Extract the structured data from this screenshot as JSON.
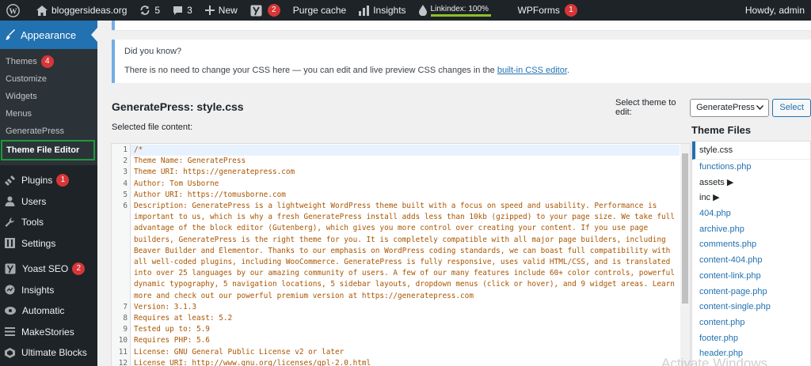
{
  "adminbar": {
    "site_name": "bloggersideas.org",
    "updates_count": "5",
    "comments_count": "3",
    "new_label": "New",
    "yoast_count": "2",
    "purge_cache": "Purge cache",
    "insights": "Insights",
    "linkindex_label": "Linkindex: 100%",
    "linkindex_fraction": 1.0,
    "wpforms_label": "WPForms",
    "wpforms_count": "1",
    "howdy": "Howdy, admin"
  },
  "sidebar": {
    "appearance": "Appearance",
    "submenu": [
      {
        "label": "Themes",
        "badge": "4"
      },
      {
        "label": "Customize"
      },
      {
        "label": "Widgets"
      },
      {
        "label": "Menus"
      },
      {
        "label": "GeneratePress"
      },
      {
        "label": "Theme File Editor",
        "current": true
      }
    ],
    "plugins": "Plugins",
    "plugins_badge": "1",
    "users": "Users",
    "tools": "Tools",
    "settings": "Settings",
    "yoast": "Yoast SEO",
    "yoast_badge": "2",
    "insights": "Insights",
    "automatic": "Automatic",
    "makestories": "MakeStories",
    "ultimate_blocks": "Ultimate Blocks"
  },
  "notice": {
    "title": "Did you know?",
    "text_before": "There is no need to change your CSS here — you can edit and live preview CSS changes in the ",
    "link": "built-in CSS editor",
    "text_after": "."
  },
  "editor": {
    "title": "GeneratePress: style.css",
    "select_label": "Select theme to edit:",
    "selected_theme": "GeneratePress",
    "select_button": "Select",
    "selected_file_content": "Selected file content:",
    "lines": [
      {
        "n": "1",
        "text": "/*"
      },
      {
        "n": "2",
        "text": "Theme Name: GeneratePress"
      },
      {
        "n": "3",
        "text": "Theme URI: https://generatepress.com"
      },
      {
        "n": "4",
        "text": "Author: Tom Usborne"
      },
      {
        "n": "5",
        "text": "Author URI: https://tomusborne.com"
      },
      {
        "n": "6",
        "text": "Description: GeneratePress is a lightweight WordPress theme built with a focus on speed and usability. Performance is important to us, which is why a fresh GeneratePress install adds less than 10kb (gzipped) to your page size. We take full advantage of the block editor (Gutenberg), which gives you more control over creating your content. If you use page builders, GeneratePress is the right theme for you. It is completely compatible with all major page builders, including Beaver Builder and Elementor. Thanks to our emphasis on WordPress coding standards, we can boast full compatibility with all well-coded plugins, including WooCommerce. GeneratePress is fully responsive, uses valid HTML/CSS, and is translated into over 25 languages by our amazing community of users. A few of our many features include 60+ color controls, powerful dynamic typography, 5 navigation locations, 5 sidebar layouts, dropdown menus (click or hover), and 9 widget areas. Learn more and check out our powerful premium version at https://generatepress.com"
      },
      {
        "n": "7",
        "text": "Version: 3.1.3"
      },
      {
        "n": "8",
        "text": "Requires at least: 5.2"
      },
      {
        "n": "9",
        "text": "Tested up to: 5.9"
      },
      {
        "n": "10",
        "text": "Requires PHP: 5.6"
      },
      {
        "n": "11",
        "text": "License: GNU General Public License v2 or later"
      },
      {
        "n": "12",
        "text": "License URI: http://www.gnu.org/licenses/gpl-2.0.html"
      }
    ]
  },
  "theme_files": {
    "title": "Theme Files",
    "files": [
      {
        "name": "style.css",
        "current": true
      },
      {
        "name": "functions.php"
      },
      {
        "name": "assets ▶",
        "dir": true
      },
      {
        "name": "inc ▶",
        "dir": true
      },
      {
        "name": "404.php"
      },
      {
        "name": "archive.php"
      },
      {
        "name": "comments.php"
      },
      {
        "name": "content-404.php"
      },
      {
        "name": "content-link.php"
      },
      {
        "name": "content-page.php"
      },
      {
        "name": "content-single.php"
      },
      {
        "name": "content.php"
      },
      {
        "name": "footer.php"
      },
      {
        "name": "header.php"
      }
    ]
  },
  "watermark": "Activate Windows",
  "colors": {
    "admin_bar": "#1d2327",
    "accent": "#2271b1",
    "badge": "#d63638",
    "current_outline": "#1c9a3a",
    "code_text": "#aa5500"
  }
}
